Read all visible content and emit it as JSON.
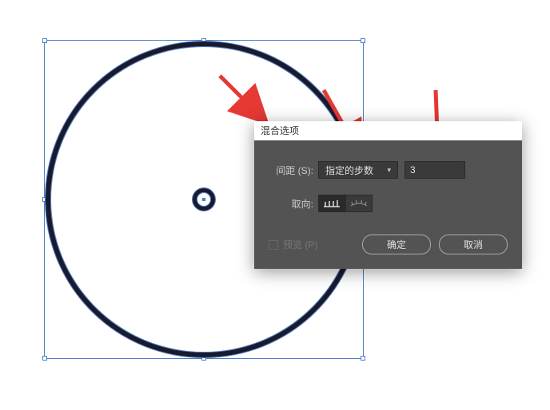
{
  "dialog": {
    "title": "混合选项",
    "spacing_label": "间距 (S):",
    "spacing_mode": "指定的步数",
    "steps_value": "3",
    "orientation_label": "取向:",
    "preview_label": "预览 (P)",
    "ok_label": "确定",
    "cancel_label": "取消"
  }
}
